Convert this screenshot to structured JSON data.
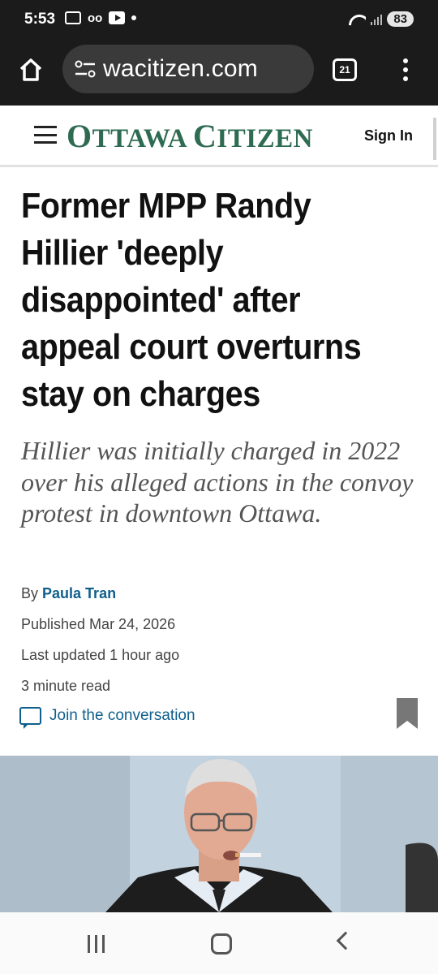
{
  "status_bar": {
    "time": "5:53",
    "voicemail": "oo",
    "battery": "83"
  },
  "browser": {
    "url": "wacitizen.com",
    "tab_count": "21"
  },
  "site": {
    "logo_first": "O",
    "logo_first_rest": "TTAWA ",
    "logo_second": "C",
    "logo_second_rest": "ITIZEN",
    "sign_in": "Sign In"
  },
  "article": {
    "headline": "Former MPP Randy Hillier 'deeply disappointed' after appeal court overturns stay on charges",
    "deck": "Hillier was initially charged in 2022 over his alleged actions in the convoy protest in downtown Ottawa.",
    "by_label": "By",
    "author": "Paula Tran",
    "published": "Published Mar 24, 2026",
    "updated": "Last updated 1 hour ago",
    "read_time": "3 minute read",
    "join_label": "Join the conversation"
  },
  "colors": {
    "brand_green": "#2e6b52",
    "link_blue": "#0f5f8c"
  }
}
